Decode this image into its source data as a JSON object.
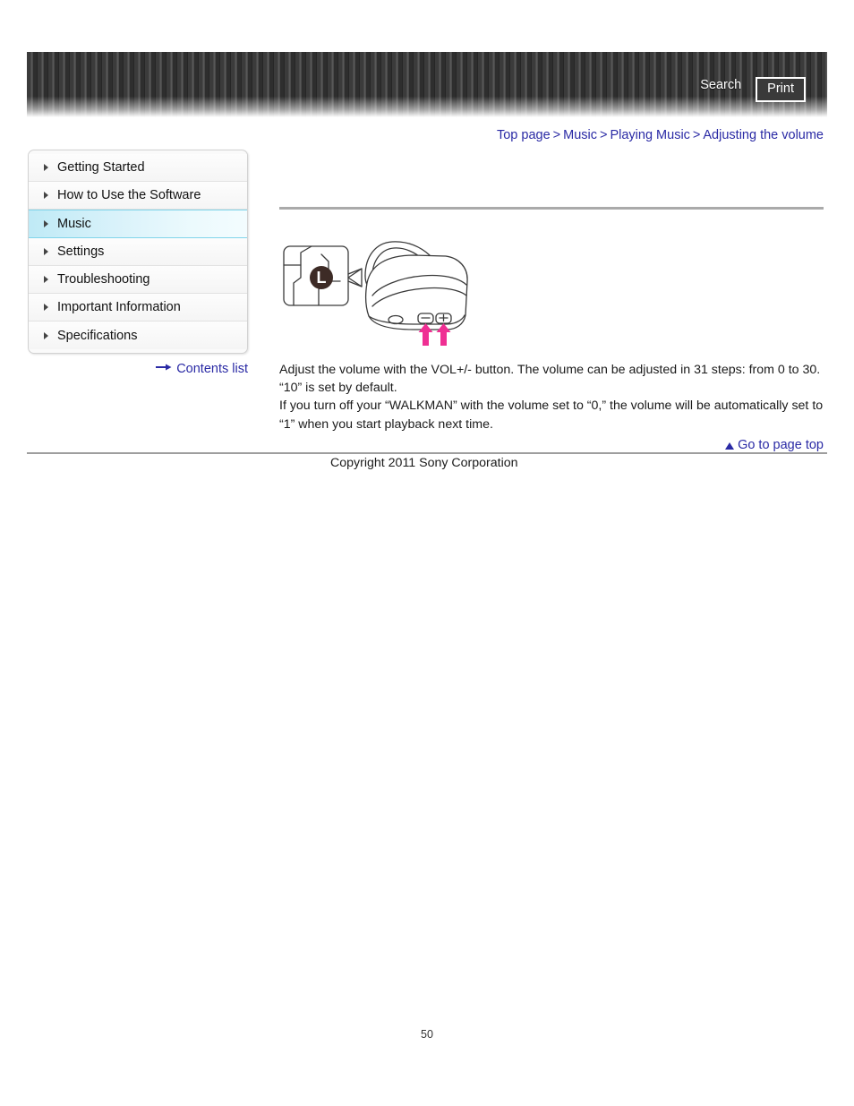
{
  "header": {
    "search_label": "Search",
    "print_label": "Print"
  },
  "breadcrumb": {
    "separator": ">",
    "items": [
      {
        "label": "Top page"
      },
      {
        "label": "Music"
      },
      {
        "label": "Playing Music"
      },
      {
        "label": "Adjusting the volume"
      }
    ]
  },
  "sidebar": {
    "items": [
      {
        "label": "Getting Started",
        "active": false
      },
      {
        "label": "How to Use the Software",
        "active": false
      },
      {
        "label": "Music",
        "active": true
      },
      {
        "label": "Settings",
        "active": false
      },
      {
        "label": "Troubleshooting",
        "active": false
      },
      {
        "label": "Important Information",
        "active": false
      },
      {
        "label": "Specifications",
        "active": false
      }
    ],
    "contents_list_label": "Contents list"
  },
  "main": {
    "figure": {
      "callout_badge": "L",
      "arrow_color": "#ef2f93",
      "description": "Line drawing of a WALKMAN player with a magnified callout showing the L mark and two pink arrows pointing up at the VOL +/- buttons"
    },
    "paragraphs": [
      "Adjust the volume with the VOL+/- button. The volume can be adjusted in 31 steps: from 0 to 30.",
      "“10” is set by default.",
      "If you turn off your “WALKMAN” with the volume set to “0,” the volume will be automatically set to",
      "“1” when you start playback next time."
    ]
  },
  "footer": {
    "page_top_label": "Go to page top",
    "copyright": "Copyright 2011 Sony Corporation",
    "page_number": "50"
  },
  "colors": {
    "link": "#2a2aa5",
    "active_nav": "#bfeaf6",
    "arrow_pink": "#ef2f93",
    "rule_gray": "#aaaaaa"
  }
}
